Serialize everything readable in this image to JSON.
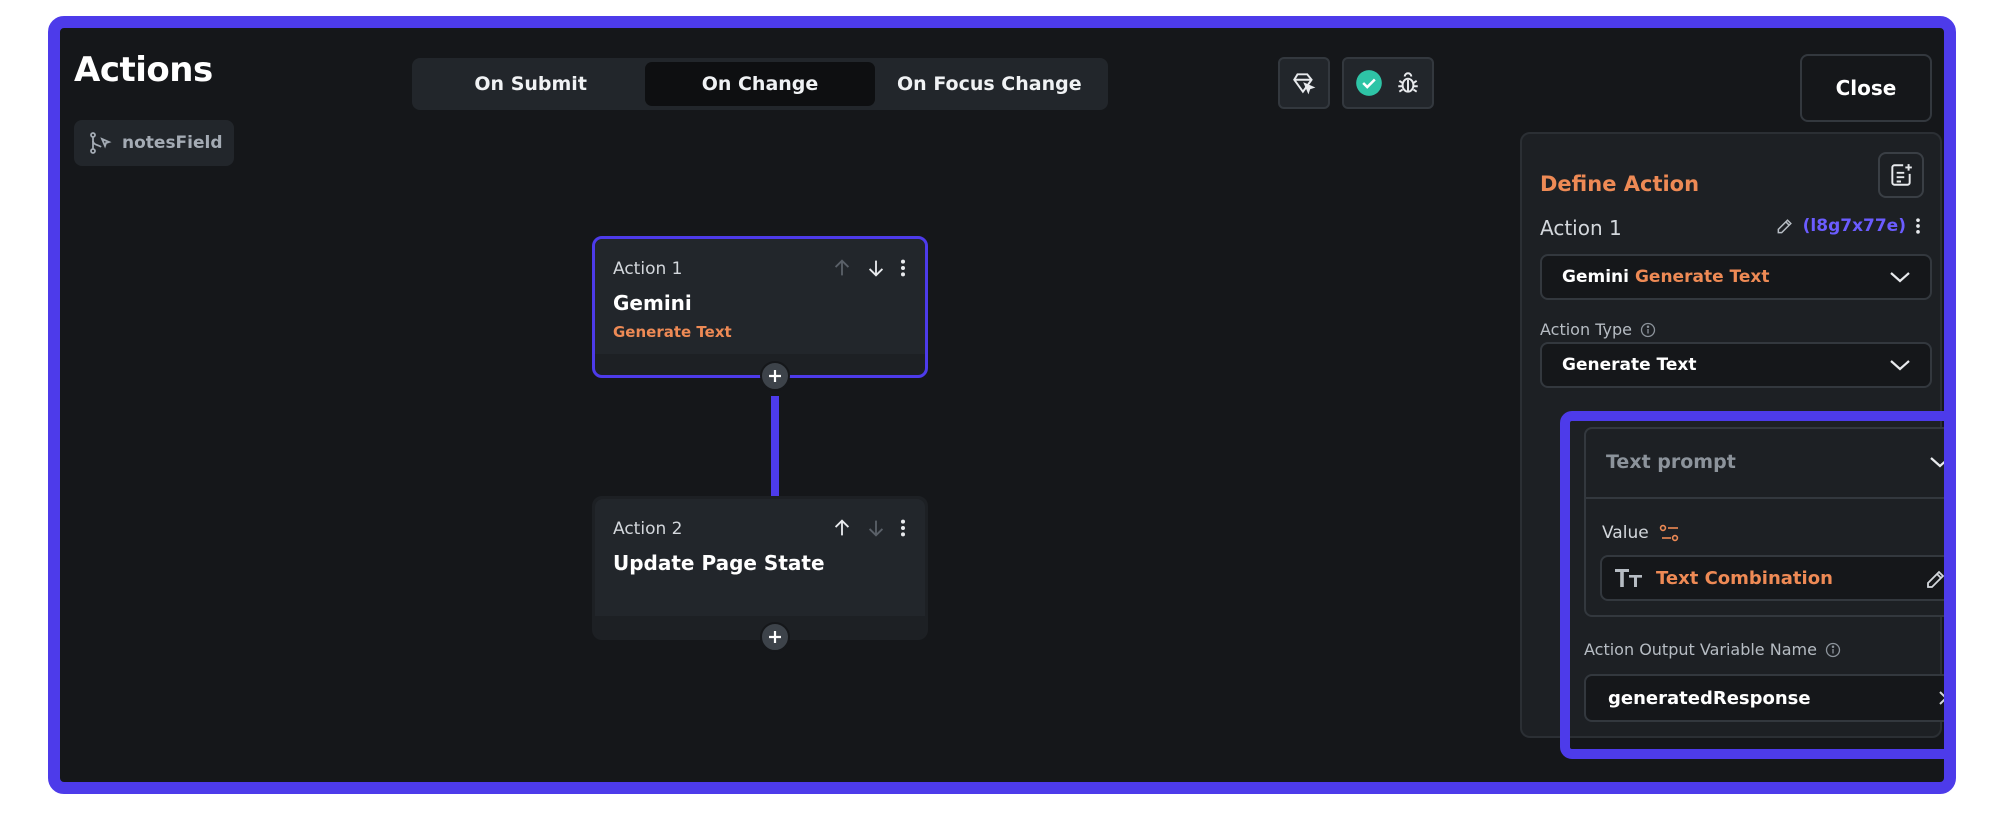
{
  "header": {
    "title": "Actions",
    "close_label": "Close"
  },
  "trigger_chip": {
    "label": "notesField"
  },
  "tabs": [
    {
      "label": "On Submit",
      "active": false
    },
    {
      "label": "On Change",
      "active": true
    },
    {
      "label": "On Focus Change",
      "active": false
    }
  ],
  "actions": [
    {
      "number": "Action 1",
      "name": "Gemini",
      "subtitle": "Generate Text"
    },
    {
      "number": "Action 2",
      "name": "Update Page State",
      "subtitle": ""
    }
  ],
  "panel": {
    "title": "Define Action",
    "action_label": "Action 1",
    "action_code": "(l8g7x77e)",
    "action_select_primary": "Gemini",
    "action_select_secondary": "Generate Text",
    "action_type_label": "Action Type",
    "action_type_value": "Generate Text",
    "text_prompt_label": "Text prompt",
    "value_label": "Value",
    "value_text": "Text Combination",
    "output_label": "Action Output Variable Name",
    "output_value": "generatedResponse"
  },
  "colors": {
    "accent": "#4d3bea",
    "orange": "#ee8a55",
    "teal": "#2ec4a6",
    "background": "#15171a"
  }
}
